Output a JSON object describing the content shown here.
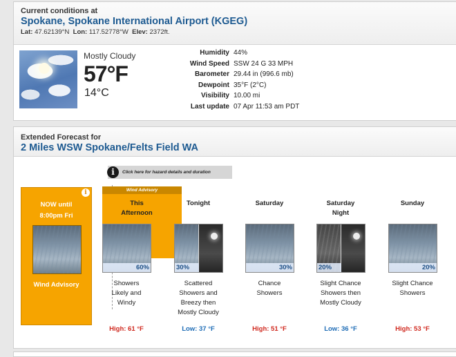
{
  "current": {
    "header_small": "Current conditions at",
    "station": "Spokane, Spokane International Airport (KGEG)",
    "lat_label": "Lat:",
    "lat": "47.62139°N",
    "lon_label": "Lon:",
    "lon": "117.52778°W",
    "elev_label": "Elev:",
    "elev": "2372ft.",
    "condition": "Mostly Cloudy",
    "temp_f": "57°F",
    "temp_c": "14°C",
    "icon": "mostly-cloudy-icon",
    "details": [
      {
        "label": "Humidity",
        "value": "44%"
      },
      {
        "label": "Wind Speed",
        "value": "SSW 24 G 33 MPH"
      },
      {
        "label": "Barometer",
        "value": "29.44 in (996.6 mb)"
      },
      {
        "label": "Dewpoint",
        "value": "35°F (2°C)"
      },
      {
        "label": "Visibility",
        "value": "10.00 mi"
      },
      {
        "label": "Last update",
        "value": "07 Apr 11:53 am PDT"
      }
    ]
  },
  "extended": {
    "header_small": "Extended Forecast for",
    "location": "2 Miles WSW Spokane/Felts Field WA",
    "hazard_button": "Click here for hazard details and duration",
    "now": {
      "line1": "NOW until",
      "line2": "8:00pm Fri",
      "advisory": "Wind Advisory"
    },
    "advisory_tag": "Wind Advisory",
    "periods": [
      {
        "name1": "This",
        "name2": "Afternoon",
        "pct": "60%",
        "short": [
          "Showers",
          "Likely and",
          "Windy"
        ],
        "hilo": "High: 61 °F",
        "kind": "hi"
      },
      {
        "name1": "Tonight",
        "name2": "",
        "pct": "30%",
        "short": [
          "Scattered",
          "Showers and",
          "Breezy then",
          "Mostly Cloudy"
        ],
        "hilo": "Low: 37 °F",
        "kind": "lo"
      },
      {
        "name1": "Saturday",
        "name2": "",
        "pct": "30%",
        "short": [
          "Chance",
          "Showers"
        ],
        "hilo": "High: 51 °F",
        "kind": "hi"
      },
      {
        "name1": "Saturday",
        "name2": "Night",
        "pct": "20%",
        "short": [
          "Slight Chance",
          "Showers then",
          "Mostly Cloudy"
        ],
        "hilo": "Low: 36 °F",
        "kind": "lo"
      },
      {
        "name1": "Sunday",
        "name2": "",
        "pct": "20%",
        "short": [
          "Slight Chance",
          "Showers"
        ],
        "hilo": "High: 53 °F",
        "kind": "hi"
      }
    ]
  },
  "colors": {
    "title_blue": "#1d5a91",
    "advisory_orange": "#f6a400",
    "high_red": "#d0281e",
    "low_blue": "#1c6bb5"
  }
}
